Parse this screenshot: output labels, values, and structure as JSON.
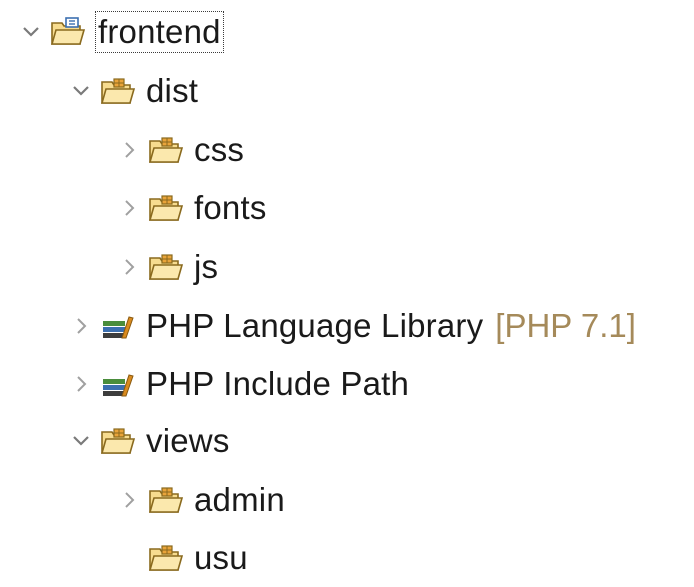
{
  "tree": {
    "root": {
      "label": "frontend",
      "expanded": true,
      "icon": "project-folder-icon"
    },
    "dist": {
      "label": "dist",
      "expanded": true,
      "icon": "package-folder-icon"
    },
    "dist_children": [
      {
        "label": "css",
        "expanded": false,
        "icon": "package-folder-icon"
      },
      {
        "label": "fonts",
        "expanded": false,
        "icon": "package-folder-icon"
      },
      {
        "label": "js",
        "expanded": false,
        "icon": "package-folder-icon"
      }
    ],
    "libraries": [
      {
        "label": "PHP Language Library",
        "decoration": "[PHP 7.1]",
        "expanded": false,
        "icon": "library-icon"
      },
      {
        "label": "PHP Include Path",
        "expanded": false,
        "icon": "library-icon"
      }
    ],
    "views": {
      "label": "views",
      "expanded": true,
      "icon": "package-folder-icon"
    },
    "views_children": [
      {
        "label": "admin",
        "expanded": false,
        "icon": "package-folder-icon"
      },
      {
        "label": "usu",
        "has_children": false,
        "icon": "package-folder-icon"
      }
    ]
  },
  "colors": {
    "text": "#1a1a1a",
    "decoration": "#a58a5a",
    "twisty": "#7a7a7a",
    "folder_fill": "#f7dc8f",
    "folder_stroke": "#8a6a1e",
    "library_book_green": "#4a8d3c",
    "library_book_blue": "#3c6fb0",
    "library_book_orange": "#d98a1e"
  }
}
